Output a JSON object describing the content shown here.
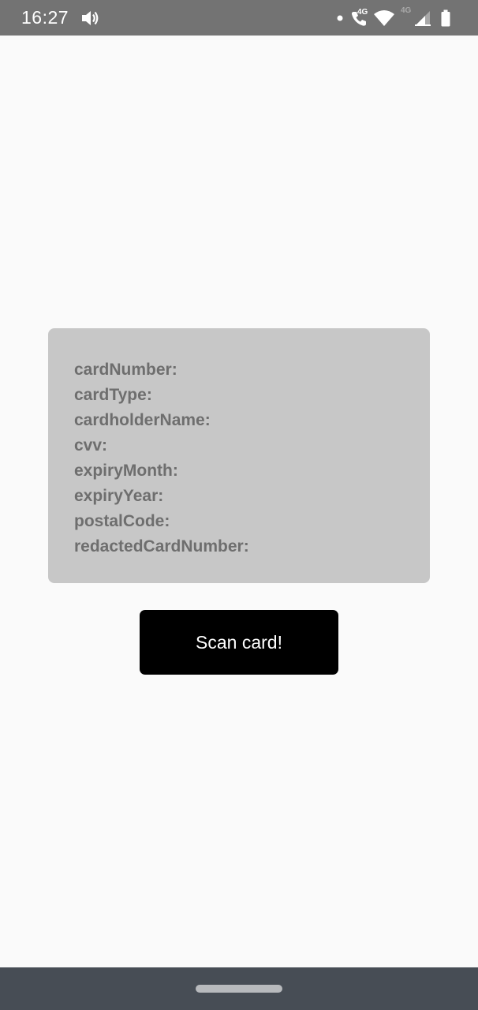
{
  "status_bar": {
    "time": "16:27",
    "network_label_1": "4G",
    "network_label_2": "4G",
    "icons": [
      "volume-icon",
      "notification-dot-icon",
      "wifi-call-icon",
      "wifi-icon",
      "cell-signal-icon",
      "battery-icon"
    ]
  },
  "card_info": {
    "fields": [
      "cardNumber:",
      "cardType:",
      "cardholderName:",
      "cvv:",
      "expiryMonth:",
      "expiryYear:",
      "postalCode:",
      "redactedCardNumber:"
    ]
  },
  "scan_button": {
    "label": "Scan card!"
  },
  "colors": {
    "status_bar": "#737373",
    "background": "#fafafa",
    "card_background": "#c7c7c7",
    "field_text": "#6e6e6e",
    "button_background": "#000000",
    "button_text": "#ffffff",
    "nav_bar": "#474d55"
  }
}
